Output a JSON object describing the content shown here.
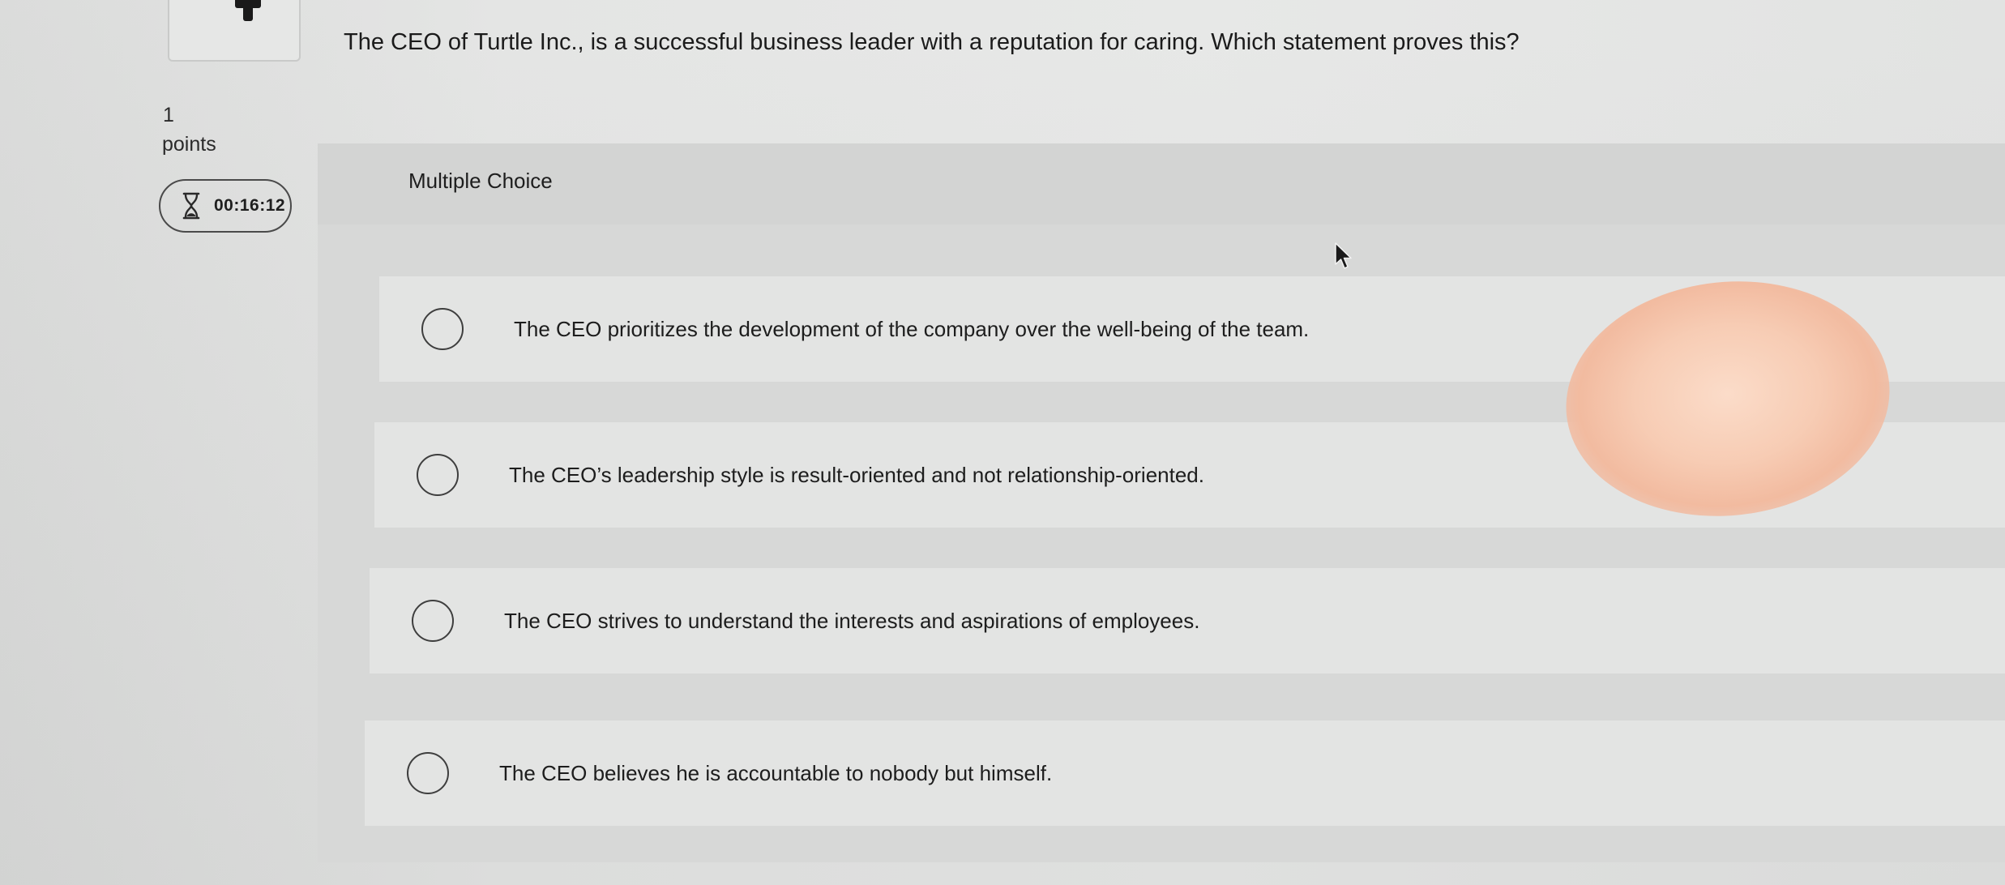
{
  "question": {
    "points_value": "1",
    "points_label": "points",
    "timer": "00:16:12",
    "text": "The CEO of Turtle Inc., is a successful business leader with a reputation for caring. Which statement proves this?",
    "type_label": "Multiple Choice"
  },
  "options": [
    {
      "label": "The CEO prioritizes the development of the company over the well-being of the team."
    },
    {
      "label": "The CEO’s leadership style is result-oriented and not relationship-oriented."
    },
    {
      "label": "The CEO strives to understand the interests and aspirations of employees."
    },
    {
      "label": "The CEO believes he is accountable to nobody but himself."
    }
  ],
  "icons": {
    "timer": "hourglass-icon",
    "option": "radio-button-icon",
    "cursor": "mouse-pointer-icon"
  },
  "colors": {
    "background": "#e2e3e2",
    "panel": "#d7d8d7",
    "option_card": "#e3e4e3",
    "text": "#1c1c1c"
  }
}
